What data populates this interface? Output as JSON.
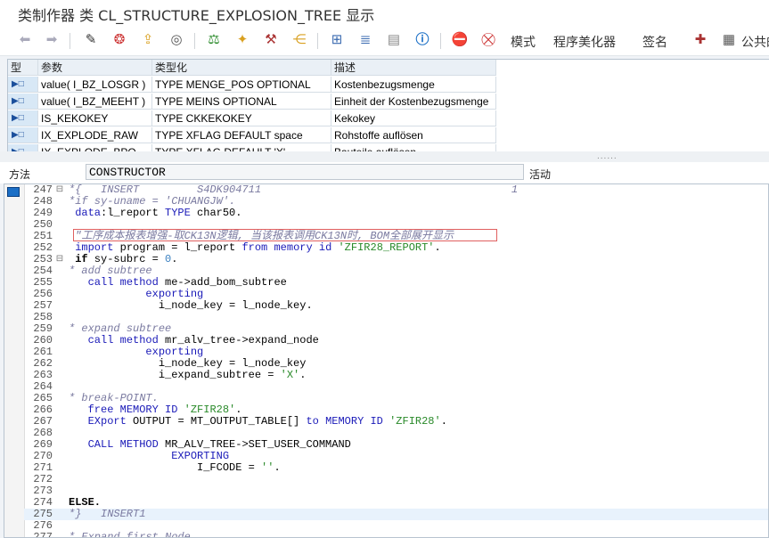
{
  "window": {
    "title": "类制作器 类 CL_STRUCTURE_EXPLOSION_TREE 显示"
  },
  "toolbar": {
    "icons": [
      "back-icon",
      "forward-icon",
      "display-change-icon",
      "other-object-icon",
      "activate-icon",
      "where-used-icon",
      "check-icon",
      "test-icon",
      "magic-wand-icon",
      "object-list-icon",
      "navigate-icon",
      "hierarchy-icon",
      "pretty-printer-icon",
      "layout-icon",
      "info-icon",
      "breakpoint-icon",
      "session-breakpoint-icon",
      "signature-icon",
      "public-icon"
    ],
    "mode_label": "模式",
    "pretty_printer_label": "程序美化器",
    "signature_label": "签名",
    "public_label": "公共的"
  },
  "params": {
    "headers": [
      "型",
      "参数",
      "类型化",
      "描述"
    ],
    "rows": [
      {
        "marker": "▶□",
        "name": "value( I_BZ_LOSGR )",
        "type": "TYPE MENGE_POS OPTIONAL",
        "desc": "Kostenbezugsmenge"
      },
      {
        "marker": "▶□",
        "name": "value( I_BZ_MEEHT )",
        "type": "TYPE MEINS OPTIONAL",
        "desc": "Einheit der Kostenbezugsmenge"
      },
      {
        "marker": "▶□",
        "name": "IS_KEKOKEY",
        "type": "TYPE CKKEKOKEY",
        "desc": "Kekokey"
      },
      {
        "marker": "▶□",
        "name": "IX_EXPLODE_RAW",
        "type": "TYPE XFLAG  DEFAULT space",
        "desc": "Rohstoffe auflösen"
      },
      {
        "marker": "▶□",
        "name": "IX_EXPLODE_BPO",
        "type": "TYPE XFLAG  DEFAULT 'X'",
        "desc": "Bauteile auflösen"
      }
    ]
  },
  "method": {
    "label": "方法",
    "value": "CONSTRUCTOR",
    "status": "活动"
  },
  "code": {
    "lines": [
      {
        "n": "247",
        "ctl": "⊟",
        "parts": [
          {
            "c": "cm",
            "t": "*{   INSERT         S4DK904711                                       1"
          }
        ]
      },
      {
        "n": "248",
        "ctl": "",
        "parts": [
          {
            "c": "cm",
            "t": "*if sy-uname = 'CHUANGJW'."
          }
        ]
      },
      {
        "n": "249",
        "ctl": "",
        "parts": [
          {
            "c": "",
            "t": " "
          },
          {
            "c": "kw",
            "t": "data"
          },
          {
            "c": "",
            "t": ":l_report "
          },
          {
            "c": "kw",
            "t": "TYPE"
          },
          {
            "c": "",
            "t": " char50."
          }
        ]
      },
      {
        "n": "250",
        "ctl": "",
        "parts": [
          {
            "c": "",
            "t": ""
          }
        ]
      },
      {
        "n": "251",
        "ctl": "",
        "parts": [
          {
            "c": "cm",
            "t": " \"工序成本报表增强-取CK13N逻辑, 当该报表调用CK13N时, BOM全部展开显示"
          }
        ]
      },
      {
        "n": "252",
        "ctl": "",
        "parts": [
          {
            "c": "",
            "t": " "
          },
          {
            "c": "kw",
            "t": "import"
          },
          {
            "c": "",
            "t": " program = l_report "
          },
          {
            "c": "kw",
            "t": "from memory id"
          },
          {
            "c": "",
            "t": " "
          },
          {
            "c": "st",
            "t": "'ZFIR28_REPORT'"
          },
          {
            "c": "",
            "t": "."
          }
        ]
      },
      {
        "n": "253",
        "ctl": "⊟",
        "parts": [
          {
            "c": "",
            "t": " "
          },
          {
            "c": "kwb",
            "t": "if"
          },
          {
            "c": "",
            "t": " sy-subrc = "
          },
          {
            "c": "nm",
            "t": "0"
          },
          {
            "c": "",
            "t": "."
          }
        ]
      },
      {
        "n": "254",
        "ctl": "",
        "parts": [
          {
            "c": "cm",
            "t": "* add subtree"
          }
        ]
      },
      {
        "n": "255",
        "ctl": "",
        "parts": [
          {
            "c": "",
            "t": "   "
          },
          {
            "c": "kw",
            "t": "call method"
          },
          {
            "c": "",
            "t": " me->add_bom_subtree"
          }
        ]
      },
      {
        "n": "256",
        "ctl": "",
        "parts": [
          {
            "c": "",
            "t": "            "
          },
          {
            "c": "kw",
            "t": "exporting"
          }
        ]
      },
      {
        "n": "257",
        "ctl": "",
        "parts": [
          {
            "c": "",
            "t": "              i_node_key = l_node_key."
          }
        ]
      },
      {
        "n": "258",
        "ctl": "",
        "parts": [
          {
            "c": "",
            "t": ""
          }
        ]
      },
      {
        "n": "259",
        "ctl": "",
        "parts": [
          {
            "c": "cm",
            "t": "* expand subtree"
          }
        ]
      },
      {
        "n": "260",
        "ctl": "",
        "parts": [
          {
            "c": "",
            "t": "   "
          },
          {
            "c": "kw",
            "t": "call method"
          },
          {
            "c": "",
            "t": " mr_alv_tree->expand_node"
          }
        ]
      },
      {
        "n": "261",
        "ctl": "",
        "parts": [
          {
            "c": "",
            "t": "            "
          },
          {
            "c": "kw",
            "t": "exporting"
          }
        ]
      },
      {
        "n": "262",
        "ctl": "",
        "parts": [
          {
            "c": "",
            "t": "              i_node_key = l_node_key"
          }
        ]
      },
      {
        "n": "263",
        "ctl": "",
        "parts": [
          {
            "c": "",
            "t": "              i_expand_subtree = "
          },
          {
            "c": "st",
            "t": "'X'"
          },
          {
            "c": "",
            "t": "."
          }
        ]
      },
      {
        "n": "264",
        "ctl": "",
        "parts": [
          {
            "c": "",
            "t": ""
          }
        ]
      },
      {
        "n": "265",
        "ctl": "",
        "parts": [
          {
            "c": "cm",
            "t": "* break-POINT."
          }
        ]
      },
      {
        "n": "266",
        "ctl": "",
        "parts": [
          {
            "c": "",
            "t": "   "
          },
          {
            "c": "kw",
            "t": "free MEMORY ID"
          },
          {
            "c": "",
            "t": " "
          },
          {
            "c": "st",
            "t": "'ZFIR28'"
          },
          {
            "c": "",
            "t": "."
          }
        ]
      },
      {
        "n": "267",
        "ctl": "",
        "parts": [
          {
            "c": "",
            "t": "   "
          },
          {
            "c": "kw",
            "t": "EXport"
          },
          {
            "c": "",
            "t": " OUTPUT = MT_OUTPUT_TABLE[] "
          },
          {
            "c": "kw",
            "t": "to MEMORY ID"
          },
          {
            "c": "",
            "t": " "
          },
          {
            "c": "st",
            "t": "'ZFIR28'"
          },
          {
            "c": "",
            "t": "."
          }
        ]
      },
      {
        "n": "268",
        "ctl": "",
        "parts": [
          {
            "c": "",
            "t": ""
          }
        ]
      },
      {
        "n": "269",
        "ctl": "",
        "parts": [
          {
            "c": "",
            "t": "   "
          },
          {
            "c": "kw",
            "t": "CALL METHOD"
          },
          {
            "c": "",
            "t": " MR_ALV_TREE->SET_USER_COMMAND"
          }
        ]
      },
      {
        "n": "270",
        "ctl": "",
        "parts": [
          {
            "c": "",
            "t": "                "
          },
          {
            "c": "kw",
            "t": "EXPORTING"
          }
        ]
      },
      {
        "n": "271",
        "ctl": "",
        "parts": [
          {
            "c": "",
            "t": "                    I_FCODE = "
          },
          {
            "c": "st",
            "t": "''"
          },
          {
            "c": "",
            "t": "."
          }
        ]
      },
      {
        "n": "272",
        "ctl": "",
        "parts": [
          {
            "c": "",
            "t": ""
          }
        ]
      },
      {
        "n": "273",
        "ctl": "",
        "parts": [
          {
            "c": "",
            "t": ""
          }
        ]
      },
      {
        "n": "274",
        "ctl": "",
        "parts": [
          {
            "c": "kwb",
            "t": "ELSE."
          }
        ]
      },
      {
        "n": "275",
        "ctl": "",
        "hl": true,
        "parts": [
          {
            "c": "cm",
            "t": "*}   INSERT1"
          }
        ]
      },
      {
        "n": "276",
        "ctl": "",
        "parts": [
          {
            "c": "",
            "t": ""
          }
        ]
      },
      {
        "n": "277",
        "ctl": "",
        "parts": [
          {
            "c": "cm",
            "t": "* Expand first Node"
          }
        ]
      }
    ]
  }
}
